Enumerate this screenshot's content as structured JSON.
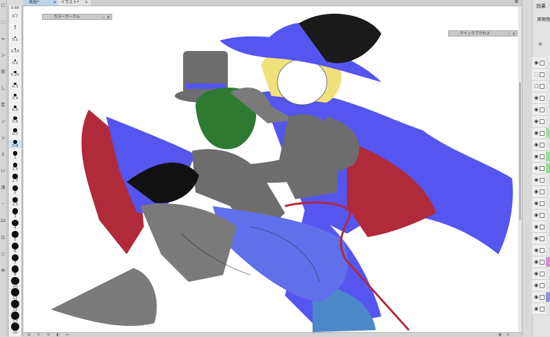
{
  "tabs": [
    {
      "label": "表紙*",
      "close": "×"
    },
    {
      "label": "イラスト*",
      "close": "×"
    }
  ],
  "tab_close_all": "×",
  "zoom_value": "0.80",
  "brush_sizes": [
    "0.7",
    "1",
    "0.1",
    "0.15",
    "0.2",
    "0.25",
    "0.3",
    "0.4",
    "0.5",
    "0.6",
    "0.7",
    "0.8",
    "1",
    "1.5",
    "1.7",
    "2",
    "2.5",
    "3",
    "4",
    "5",
    "6",
    "7",
    "8",
    "10",
    "12",
    "15",
    "17",
    "20"
  ],
  "left_tool_glyphs": [
    "☐",
    "⬚",
    "↔",
    "ン",
    "放",
    "し",
    "定",
    "ン",
    "ン",
    "ミ",
    "い",
    "頂",
    "・",
    "22",
    "◫",
    "◻",
    "⊞"
  ],
  "panels": {
    "color_circle": {
      "title": "カラーサークル",
      "min": "–",
      "close": "×"
    },
    "quick_access": {
      "title": "クイックアクセス",
      "min": "–",
      "close": "×"
    }
  },
  "right_panel": {
    "title": "効果",
    "subtitle": "表現色",
    "menu": "≡"
  },
  "layer_marks": [
    "◉",
    "⬚",
    "▢",
    "◉",
    "◉",
    "◉",
    "◉",
    "◉",
    "◉",
    "◉",
    "◉",
    "◉",
    "◉",
    "◉",
    "◉",
    "◉",
    "◉",
    "◉",
    "◉",
    "◉",
    "◉",
    "◉"
  ],
  "layer_colors": [
    "#e3e3e3",
    "#e3e3e3",
    "#e3e3e3",
    "#e3e3e3",
    "#e3e3e3",
    "#e3e3e3",
    "#a9d8a9",
    "#e3e3e3",
    "#8fe38f",
    "#8fe38f",
    "#e3e3e3",
    "#e3e3e3",
    "#e3e3e3",
    "#e3e3e3",
    "#e3e3e3",
    "#e3e3e3",
    "#e3e3e3",
    "#d98ad9",
    "#e3e3e3",
    "#e3e3e3",
    "#8f8fe3",
    "#e3e3e3"
  ],
  "bottom_bar": {
    "left_icons": [
      "⊞",
      "↻",
      "⟲",
      "◧",
      "⇔"
    ],
    "right_icons": [
      "▣",
      "≡"
    ]
  },
  "colors": {
    "cape_blue": "#5555f0",
    "cape_red": "#b02a3a",
    "gray_clothes": "#6d6d6d",
    "hair_green": "#2e7a33",
    "hair_blonde": "#f0e27a",
    "pant_blue": "#6070ea",
    "boot_gray": "#7a7a7a",
    "bag_blue": "#4d89c9"
  }
}
